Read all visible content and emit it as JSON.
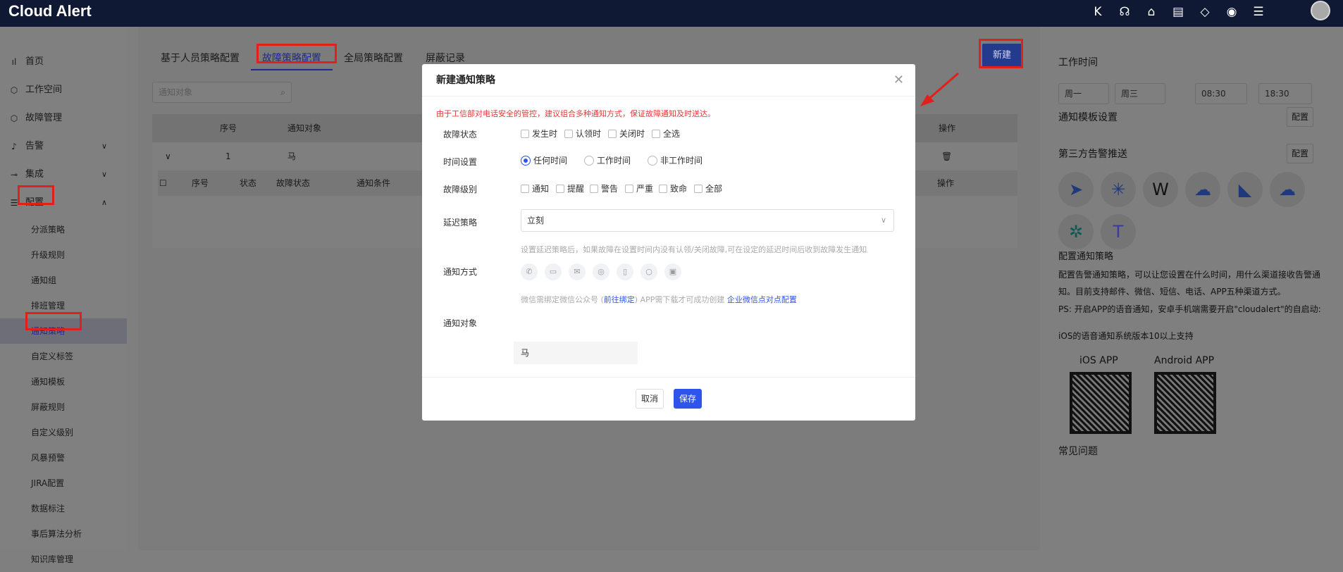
{
  "app": {
    "title": "Cloud Alert"
  },
  "topbar": {
    "icons": [
      "k-logo-icon",
      "headset-icon",
      "inbox-icon",
      "book-icon",
      "diamond-icon",
      "help-icon",
      "sliders-icon"
    ]
  },
  "sidebar": {
    "items": [
      {
        "label": "首页",
        "icon": "chart-icon"
      },
      {
        "label": "工作空间",
        "icon": "cube-icon"
      },
      {
        "label": "故障管理",
        "icon": "cube-icon"
      },
      {
        "label": "告警",
        "icon": "bell-icon"
      },
      {
        "label": "集成",
        "icon": "plug-icon"
      },
      {
        "label": "配置",
        "icon": "settings-icon"
      }
    ],
    "subitems": [
      "分派策略",
      "升级规则",
      "通知组",
      "排班管理",
      "通知策略",
      "自定义标签",
      "通知模板",
      "屏蔽规则",
      "自定义级别",
      "风暴预警",
      "JIRA配置",
      "数据标注",
      "事后算法分析",
      "知识库管理"
    ]
  },
  "main": {
    "tabs": [
      "基于人员策略配置",
      "故障策略配置",
      "全局策略配置",
      "屏蔽记录"
    ],
    "new_button": "新建",
    "search_placeholder": "通知对象",
    "table": {
      "headers": [
        "序号",
        "通知对象",
        "操作"
      ],
      "row": {
        "index": "1",
        "target": "马"
      },
      "sub_headers": [
        "序号",
        "状态",
        "故障状态",
        "通知条件",
        "操作"
      ]
    }
  },
  "modal": {
    "title": "新建通知策略",
    "warning": "由于工信部对电话安全的管控，建议组合多种通知方式，保证故障通知及时送达。",
    "fault_status": {
      "label": "故障状态",
      "options": [
        "发生时",
        "认领时",
        "关闭时",
        "全选"
      ]
    },
    "time": {
      "label": "时间设置",
      "options": [
        "任何时间",
        "工作时间",
        "非工作时间"
      ],
      "selected": "任何时间"
    },
    "level": {
      "label": "故障级别",
      "options": [
        "通知",
        "提醒",
        "警告",
        "严重",
        "致命",
        "全部"
      ]
    },
    "delay": {
      "label": "延迟策略",
      "value": "立刻",
      "hint": "设置延迟策略后，如果故障在设置时间内没有认领/关闭故障,可在设定的延迟时间后收到故障发生通知"
    },
    "method": {
      "label": "通知方式",
      "icons": [
        "phone-icon",
        "sms-icon",
        "mail-icon",
        "wechat-icon",
        "mobile-icon",
        "chat-icon",
        "app-icon"
      ],
      "hint_prefix": "微信需绑定微信公众号 (",
      "hint_link": "前往绑定",
      "hint_mid": ") APP需下载才可成功创建 ",
      "hint_link2": "企业微信点对点配置"
    },
    "target": {
      "label": "通知对象",
      "value": "马"
    },
    "cancel": "取消",
    "save": "保存"
  },
  "right": {
    "work_time": "工作时间",
    "day_from": "周一",
    "day_to": "周三",
    "time_from": "08:30",
    "time_to": "18:30",
    "template": "通知模板设置",
    "template_btn": "配置",
    "third": "第三方告警推送",
    "third_btn": "配置",
    "channels": [
      "dingtalk-icon",
      "slack-icon",
      "W",
      "chat-bubble-icon",
      "feishu-icon",
      "cloud-icon",
      "asterisk-icon",
      "teams-icon"
    ],
    "config_title": "配置通知策略",
    "desc1": "配置告警通知策略，可以让您设置在什么时间，用什么渠道接收告警通知。目前支持邮件、微信、短信、电话、APP五种渠道方式。",
    "desc2": "PS: 开启APP的语音通知，安卓手机端需要开启\"cloudalert\"的自启动:",
    "desc3": "iOS的语音通知系统版本10以上支持",
    "ios": "iOS APP",
    "android": "Android APP",
    "faq": "常见问题"
  }
}
